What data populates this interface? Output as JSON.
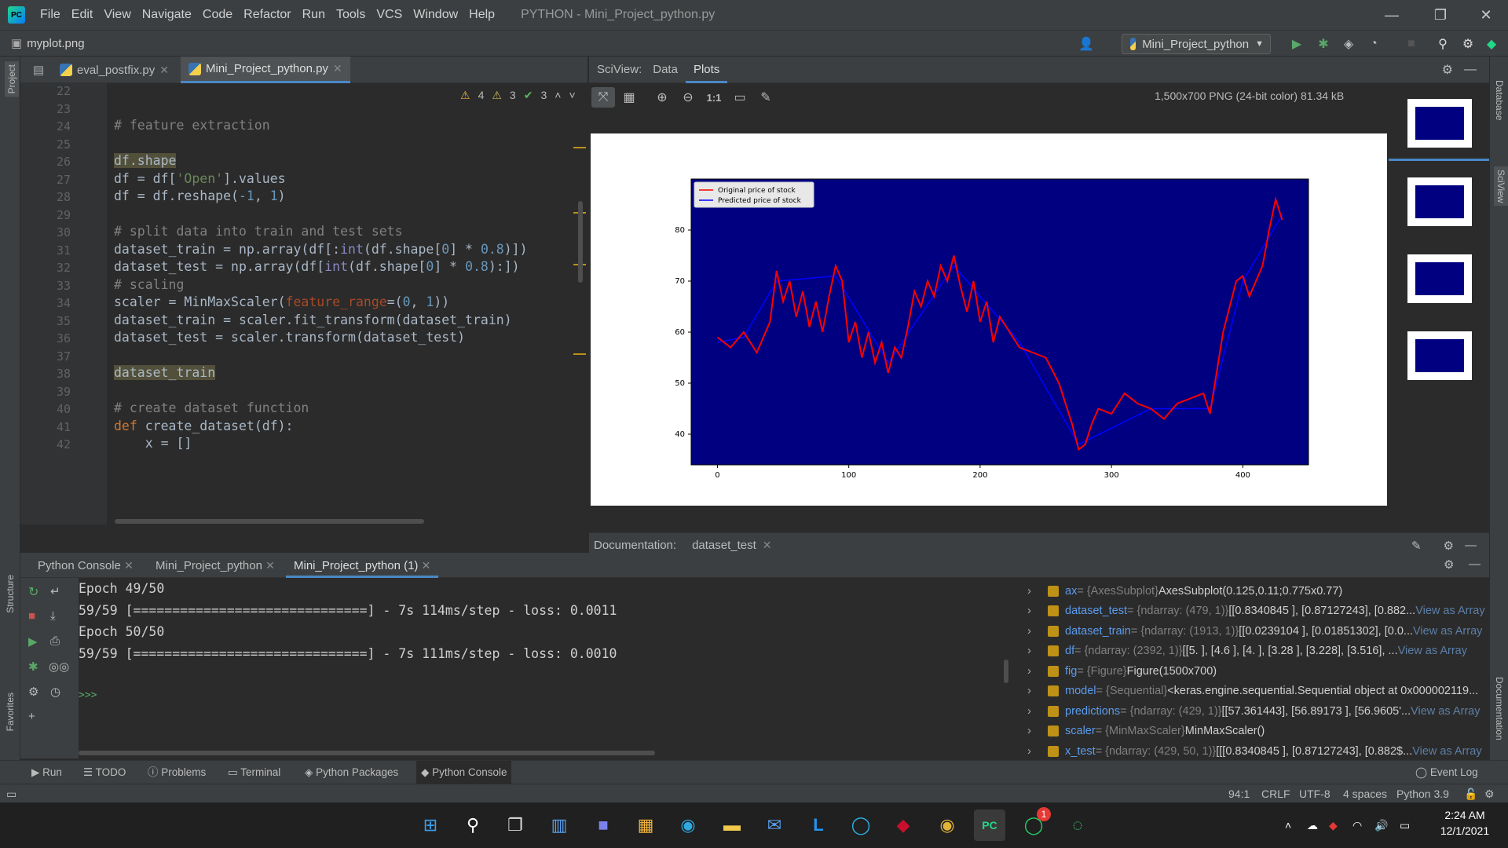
{
  "app": {
    "window_title": "PYTHON - Mini_Project_python.py",
    "menu": [
      "File",
      "Edit",
      "View",
      "Navigate",
      "Code",
      "Refactor",
      "Run",
      "Tools",
      "VCS",
      "Window",
      "Help"
    ]
  },
  "nav": {
    "file": "myplot.png",
    "run_config": "Mini_Project_python"
  },
  "left_strip": {
    "project": "Project",
    "structure": "Structure",
    "favorites": "Favorites"
  },
  "right_strip": {
    "database": "Database",
    "sciview": "SciView",
    "documentation": "Documentation"
  },
  "editor": {
    "tabs": [
      {
        "label": "eval_postfix.py"
      },
      {
        "label": "Mini_Project_python.py",
        "active": true
      }
    ],
    "inspections": {
      "warnings": "4",
      "weak": "3",
      "ok": "3"
    },
    "lines": [
      {
        "n": "22",
        "t": ""
      },
      {
        "n": "23",
        "t": ""
      },
      {
        "n": "24",
        "t": "# feature extraction"
      },
      {
        "n": "25",
        "t": ""
      },
      {
        "n": "26",
        "t": "df.shape"
      },
      {
        "n": "27",
        "t": "df = df['Open'].values"
      },
      {
        "n": "28",
        "t": "df = df.reshape(-1, 1)"
      },
      {
        "n": "29",
        "t": ""
      },
      {
        "n": "30",
        "t": "# split data into train and test sets"
      },
      {
        "n": "31",
        "t": "dataset_train = np.array(df[:int(df.shape[0] * 0.8)])"
      },
      {
        "n": "32",
        "t": "dataset_test = np.array(df[int(df.shape[0] * 0.8):])"
      },
      {
        "n": "33",
        "t": "# scaling"
      },
      {
        "n": "34",
        "t": "scaler = MinMaxScaler(feature_range=(0, 1))"
      },
      {
        "n": "35",
        "t": "dataset_train = scaler.fit_transform(dataset_train)"
      },
      {
        "n": "36",
        "t": "dataset_test = scaler.transform(dataset_test)"
      },
      {
        "n": "37",
        "t": ""
      },
      {
        "n": "38",
        "t": "dataset_train"
      },
      {
        "n": "39",
        "t": ""
      },
      {
        "n": "40",
        "t": "# create dataset function"
      },
      {
        "n": "41",
        "t": "def create_dataset(df):"
      },
      {
        "n": "42",
        "t": "    x = []"
      }
    ]
  },
  "sciview": {
    "label": "SciView:",
    "tabs": [
      "Data",
      "Plots"
    ],
    "image_info": "1,500x700 PNG (24-bit color) 81.34 kB",
    "zoom_label": "1:1"
  },
  "documentation": {
    "label": "Documentation:",
    "item": "dataset_test"
  },
  "console": {
    "tabs": [
      "Python Console",
      "Mini_Project_python",
      "Mini_Project_python (1)"
    ],
    "lines": [
      "Epoch 49/50",
      "59/59 [==============================] - 7s 114ms/step - loss: 0.0011",
      "Epoch 50/50",
      "59/59 [==============================] - 7s 111ms/step - loss: 0.0010"
    ],
    "prompt": ">>>"
  },
  "variables": [
    {
      "name": "ax",
      "type": " = {AxesSubplot} ",
      "value": "AxesSubplot(0.125,0.11;0.775x0.77)",
      "link": ""
    },
    {
      "name": "dataset_test",
      "type": " = {ndarray: (479, 1)} ",
      "value": "[[0.8340845 ], [0.87127243], [0.882...",
      "link": "View as Array"
    },
    {
      "name": "dataset_train",
      "type": " = {ndarray: (1913, 1)} ",
      "value": "[[0.0239104 ], [0.01851302], [0.0...",
      "link": "View as Array"
    },
    {
      "name": "df",
      "type": " = {ndarray: (2392, 1)} ",
      "value": "[[5.   ], [4.6  ], [4.   ], [3.28 ], [3.228], [3.516], ...",
      "link": "View as Array"
    },
    {
      "name": "fig",
      "type": " = {Figure} ",
      "value": "Figure(1500x700)",
      "link": ""
    },
    {
      "name": "model",
      "type": " = {Sequential} ",
      "value": "<keras.engine.sequential.Sequential object at 0x000002119...",
      "link": ""
    },
    {
      "name": "predictions",
      "type": " = {ndarray: (429, 1)} ",
      "value": "[[57.361443], [56.89173 ], [56.9605'...",
      "link": "View as Array"
    },
    {
      "name": "scaler",
      "type": " = {MinMaxScaler} ",
      "value": "MinMaxScaler()",
      "link": ""
    },
    {
      "name": "x_test",
      "type": " = {ndarray: (429, 50, 1)} ",
      "value": "[[[0.8340845 ],  [0.87127243],  [0.882$...",
      "link": "View as Array"
    }
  ],
  "bottom_tools": [
    "Run",
    "TODO",
    "Problems",
    "Terminal",
    "Python Packages",
    "Python Console",
    "Event Log"
  ],
  "status": {
    "pos": "94:1",
    "eol": "CRLF",
    "enc": "UTF-8",
    "indent": "4 spaces",
    "interp": "Python 3.9"
  },
  "taskbar": {
    "time": "2:24 AM",
    "date": "12/1/2021",
    "badge": "1"
  },
  "chart_data": {
    "type": "line",
    "x_ticks": [
      0,
      100,
      200,
      300,
      400
    ],
    "y_ticks": [
      40,
      50,
      60,
      70,
      80
    ],
    "xlim": [
      -20,
      450
    ],
    "ylim": [
      34,
      90
    ],
    "background": "#000080",
    "legend": "top-left",
    "series": [
      {
        "name": "Original price of stock",
        "color": "#ff0000",
        "points": [
          [
            0,
            59
          ],
          [
            10,
            57
          ],
          [
            20,
            60
          ],
          [
            30,
            56
          ],
          [
            40,
            62
          ],
          [
            45,
            72
          ],
          [
            50,
            66
          ],
          [
            55,
            70
          ],
          [
            60,
            63
          ],
          [
            65,
            68
          ],
          [
            70,
            61
          ],
          [
            75,
            66
          ],
          [
            80,
            60
          ],
          [
            85,
            67
          ],
          [
            90,
            73
          ],
          [
            95,
            70
          ],
          [
            100,
            58
          ],
          [
            105,
            62
          ],
          [
            110,
            55
          ],
          [
            115,
            60
          ],
          [
            120,
            54
          ],
          [
            125,
            58
          ],
          [
            130,
            52
          ],
          [
            135,
            57
          ],
          [
            140,
            55
          ],
          [
            145,
            61
          ],
          [
            150,
            68
          ],
          [
            155,
            65
          ],
          [
            160,
            70
          ],
          [
            165,
            67
          ],
          [
            170,
            73
          ],
          [
            175,
            70
          ],
          [
            180,
            75
          ],
          [
            185,
            69
          ],
          [
            190,
            64
          ],
          [
            195,
            70
          ],
          [
            200,
            62
          ],
          [
            205,
            66
          ],
          [
            210,
            58
          ],
          [
            215,
            63
          ],
          [
            220,
            61
          ],
          [
            225,
            59
          ],
          [
            230,
            57
          ],
          [
            240,
            56
          ],
          [
            250,
            55
          ],
          [
            260,
            50
          ],
          [
            270,
            42
          ],
          [
            275,
            37
          ],
          [
            280,
            38
          ],
          [
            285,
            42
          ],
          [
            290,
            45
          ],
          [
            300,
            44
          ],
          [
            310,
            48
          ],
          [
            320,
            46
          ],
          [
            330,
            45
          ],
          [
            340,
            43
          ],
          [
            350,
            46
          ],
          [
            360,
            47
          ],
          [
            370,
            48
          ],
          [
            375,
            44
          ],
          [
            385,
            60
          ],
          [
            390,
            65
          ],
          [
            395,
            70
          ],
          [
            400,
            71
          ],
          [
            405,
            67
          ],
          [
            410,
            70
          ],
          [
            415,
            73
          ],
          [
            420,
            80
          ],
          [
            425,
            86
          ],
          [
            430,
            82
          ]
        ]
      },
      {
        "name": "Predicted price of stock",
        "color": "#0000ff",
        "points": [
          [
            0,
            58
          ],
          [
            20,
            59
          ],
          [
            45,
            70
          ],
          [
            90,
            71
          ],
          [
            130,
            54
          ],
          [
            180,
            73
          ],
          [
            230,
            58
          ],
          [
            275,
            38
          ],
          [
            330,
            45
          ],
          [
            375,
            45
          ],
          [
            400,
            70
          ],
          [
            430,
            83
          ]
        ]
      }
    ]
  }
}
